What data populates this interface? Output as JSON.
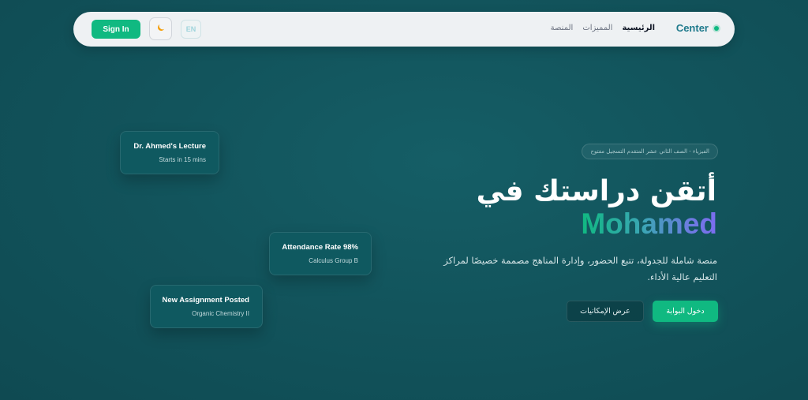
{
  "navbar": {
    "brand": "Center",
    "links": [
      "الرئيسية",
      "المميزات",
      "المنصة"
    ],
    "signin_label": "Sign In",
    "theme_icon": "moon-icon",
    "lang_label": "EN"
  },
  "hero": {
    "badge": "الفيزياء - الصف الثاني عشر المتقدم التسجيل مفتوح",
    "title": "أتقن دراستك في",
    "name": "Mohamed",
    "description": "منصة شاملة للجدولة، تتبع الحضور، وإدارة المناهج مصممة خصيصًا لمراكز التعليم عالية الأداء.",
    "primary_button": "دخول البوابة",
    "secondary_button": "عرض الإمكانيات"
  },
  "cards": [
    {
      "title": "Dr. Ahmed's Lecture",
      "subtitle": "Starts in 15 mins"
    },
    {
      "title": "Attendance Rate 98%",
      "subtitle": "Calculus Group B"
    },
    {
      "title": "New Assignment Posted",
      "subtitle": "Organic Chemistry II"
    }
  ],
  "colors": {
    "accent": "#10b981",
    "background": "#12545c",
    "navbar": "#eef1f3"
  }
}
